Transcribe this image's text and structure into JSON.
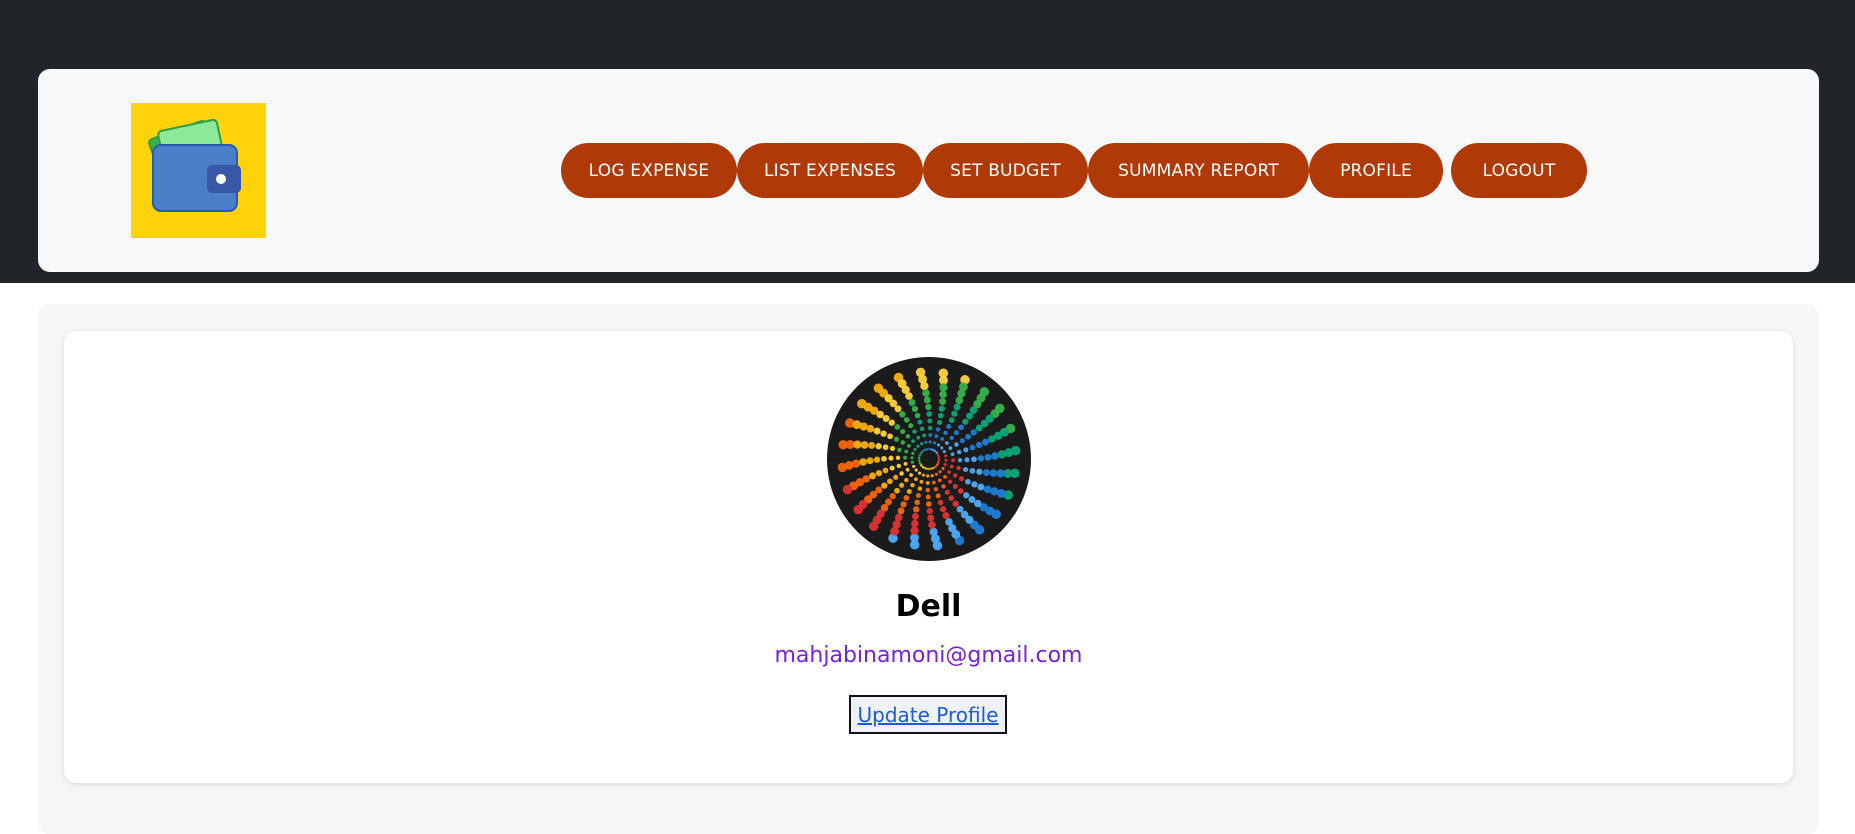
{
  "nav": {
    "logo_icon": "wallet-icon",
    "buttons": {
      "log_expense": "LOG EXPENSE",
      "list_expenses": "LIST EXPENSES",
      "set_budget": "SET BUDGET",
      "summary_report": "SUMMARY REPORT",
      "profile": "PROFILE",
      "logout": "LOGOUT"
    }
  },
  "profile": {
    "avatar_icon": "swirl-dots-avatar",
    "name": "Dell",
    "email": "mahjabinamoni@gmail.com",
    "update_label": "Update Profile"
  },
  "colors": {
    "header_bg": "#212429",
    "nav_bg": "#f8f9fa",
    "button_bg": "#b03a07",
    "logo_bg": "#ffd20a",
    "email_color": "#7622d9",
    "link_color": "#1d5bd8"
  }
}
